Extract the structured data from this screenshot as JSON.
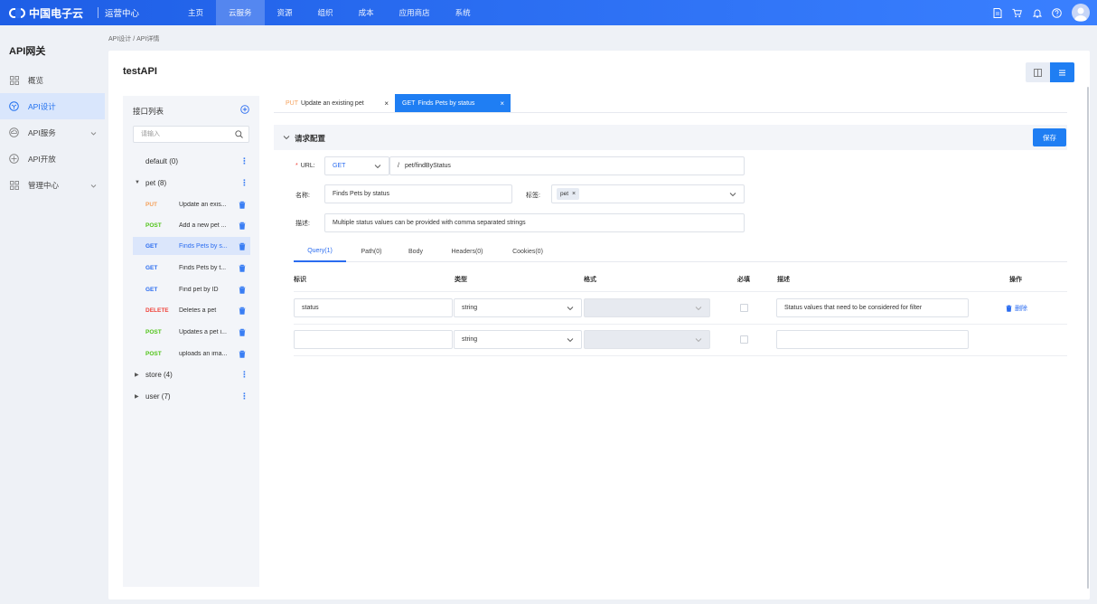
{
  "header": {
    "brand": "中国电子云",
    "center_title": "运营中心",
    "nav": [
      {
        "label": "主页",
        "active": false
      },
      {
        "label": "云服务",
        "active": true
      },
      {
        "label": "资源",
        "active": false
      },
      {
        "label": "组织",
        "active": false
      },
      {
        "label": "成本",
        "active": false
      },
      {
        "label": "应用商店",
        "active": false
      },
      {
        "label": "系统",
        "active": false
      }
    ],
    "icons": [
      "document-icon",
      "cart-icon",
      "bell-icon",
      "help-icon",
      "avatar"
    ]
  },
  "sidebar": {
    "title": "API网关",
    "items": [
      {
        "label": "概览",
        "icon": "grid-icon",
        "active": false,
        "expandable": false
      },
      {
        "label": "API设计",
        "icon": "cube-icon",
        "active": true,
        "expandable": false
      },
      {
        "label": "API服务",
        "icon": "cloud-icon",
        "active": false,
        "expandable": true
      },
      {
        "label": "API开放",
        "icon": "cloud-share-icon",
        "active": false,
        "expandable": false
      },
      {
        "label": "管理中心",
        "icon": "grid-icon",
        "active": false,
        "expandable": true
      }
    ]
  },
  "breadcrumb": "API设计 / API详情",
  "page_title": "testAPI",
  "api_list": {
    "title": "接口列表",
    "search_placeholder": "请输入",
    "groups": [
      {
        "name": "default (0)",
        "arrow": "",
        "apis": []
      },
      {
        "name": "pet (8)",
        "arrow": "▼",
        "apis": [
          {
            "method": "PUT",
            "name": "Update an exis...",
            "color": "#f5a25d",
            "selected": false
          },
          {
            "method": "POST",
            "name": "Add a new pet ...",
            "color": "#52c41a",
            "selected": false
          },
          {
            "method": "GET",
            "name": "Finds Pets by s...",
            "color": "#2a6cf0",
            "selected": true
          },
          {
            "method": "GET",
            "name": "Finds Pets by t...",
            "color": "#2a6cf0",
            "selected": false
          },
          {
            "method": "GET",
            "name": "Find pet by ID",
            "color": "#2a6cf0",
            "selected": false
          },
          {
            "method": "DELETE",
            "name": "Deletes a pet",
            "color": "#f0443b",
            "selected": false
          },
          {
            "method": "POST",
            "name": "Updates a pet i...",
            "color": "#52c41a",
            "selected": false
          },
          {
            "method": "POST",
            "name": "uploads an ima...",
            "color": "#52c41a",
            "selected": false
          }
        ]
      },
      {
        "name": "store (4)",
        "arrow": "▶",
        "apis": []
      },
      {
        "name": "user (7)",
        "arrow": "▶",
        "apis": []
      }
    ]
  },
  "tabs": [
    {
      "method": "PUT",
      "title": "Update an existing pet",
      "active": false
    },
    {
      "method": "GET",
      "title": "Finds Pets by status",
      "active": true
    }
  ],
  "request_config": {
    "title": "请求配置",
    "save_label": "保存",
    "url_label": "URL:",
    "method_value": "GET",
    "path_prefix": "/",
    "path_value": "pet/findByStatus",
    "name_label": "名称:",
    "name_value": "Finds Pets by status",
    "tag_label": "标签:",
    "tag_value": "pet",
    "desc_label": "描述:",
    "desc_value": "Multiple status values can be provided with comma separated strings"
  },
  "param_tabs": [
    {
      "label": "Query(1)",
      "active": true
    },
    {
      "label": "Path(0)",
      "active": false
    },
    {
      "label": "Body",
      "active": false
    },
    {
      "label": "Headers(0)",
      "active": false
    },
    {
      "label": "Cookies(0)",
      "active": false
    }
  ],
  "param_table": {
    "headers": [
      "标识",
      "类型",
      "格式",
      "必填",
      "描述",
      "操作"
    ],
    "rows": [
      {
        "name": "status",
        "type": "string",
        "format": "",
        "required": false,
        "description": "Status values that need to be considered for filter",
        "action": "删除"
      },
      {
        "name": "",
        "type": "string",
        "format": "",
        "required": false,
        "description": "",
        "action": ""
      }
    ]
  }
}
